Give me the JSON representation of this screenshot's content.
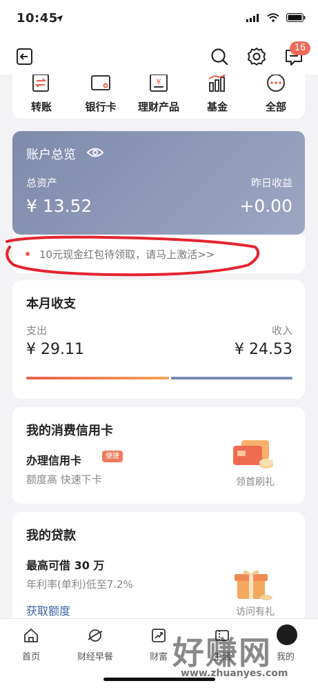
{
  "status_bar": {
    "time": "10:45"
  },
  "nav": {
    "message_badge": "16"
  },
  "quick_actions": [
    {
      "label": "转账",
      "icon": "transfer-icon"
    },
    {
      "label": "银行卡",
      "icon": "bank-card-icon"
    },
    {
      "label": "理财产品",
      "icon": "wealth-product-icon"
    },
    {
      "label": "基金",
      "icon": "fund-chart-icon"
    },
    {
      "label": "全部",
      "icon": "more-dots-icon"
    }
  ],
  "account": {
    "title": "账户总览",
    "total_label": "总资产",
    "total_value": "¥ 13.52",
    "yesterday_label": "昨日收益",
    "yesterday_value": "+0.00"
  },
  "promo": {
    "text": "10元现金红包待领取，请马上激活>>"
  },
  "monthly": {
    "title": "本月收支",
    "expense_label": "支出",
    "expense_value": "¥ 29.11",
    "income_label": "收入",
    "income_value": "¥ 24.53",
    "expense_share": 0.54
  },
  "credit_card": {
    "title": "我的消费信用卡",
    "apply": "办理信用卡",
    "tag": "便捷",
    "desc": "额度高 快速下卡",
    "gift": "领首刷礼"
  },
  "loan": {
    "title": "我的贷款",
    "max": "最高可借 30 万",
    "rate": "年利率(单利)低至7.2%",
    "get": "获取额度",
    "gift": "访问有礼"
  },
  "tabs": [
    {
      "label": "首页",
      "icon": "home-icon"
    },
    {
      "label": "财经早餐",
      "icon": "planet-icon"
    },
    {
      "label": "财富",
      "icon": "trend-chart-icon"
    },
    {
      "label": "生活",
      "icon": "ticket-icon"
    },
    {
      "label": "我的",
      "icon": "avatar"
    }
  ],
  "watermark": {
    "main": "好赚网",
    "url": "www.zhuanyes.com"
  },
  "colors": {
    "accent_red": "#e8604a",
    "link_blue": "#3d64a8",
    "account_card": "#8792b0"
  }
}
